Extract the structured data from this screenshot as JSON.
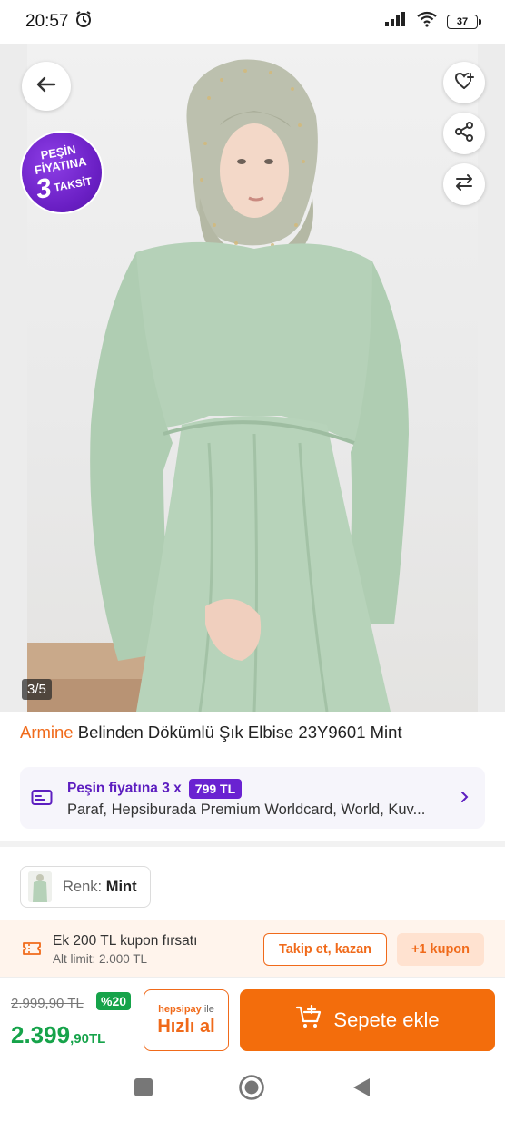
{
  "status_bar": {
    "time": "20:57",
    "battery": "37"
  },
  "gallery": {
    "page_counter": "3/5",
    "promo_badge": {
      "line1": "PEŞİN",
      "line2": "FİYATINA",
      "line3_big": "3",
      "line3_small": "TAKSİT"
    }
  },
  "product": {
    "brand": "Armine",
    "name": "Belinden Dökümlü Şık Elbise 23Y9601 Mint"
  },
  "installment": {
    "label": "Peşin fiyatına 3 x",
    "amount": "799 TL",
    "banks": "Paraf, Hepsiburada Premium Worldcard, World, Kuv..."
  },
  "color": {
    "label": "Renk:",
    "value": "Mint"
  },
  "coupon": {
    "title": "Ek 200 TL kupon fırsatı",
    "subtitle": "Alt limit: 2.000 TL",
    "follow_button": "Takip et, kazan",
    "coupon_button": "+1 kupon"
  },
  "pricing": {
    "old_price": "2.999,90 TL",
    "discount": "%20",
    "price_main": "2.399",
    "price_decimal": ",90",
    "currency": "TL"
  },
  "buttons": {
    "fast_buy_brand": "hepsipay",
    "fast_buy_with": "ile",
    "fast_buy": "Hızlı al",
    "add_to_cart": "Sepete ekle"
  },
  "colors": {
    "accent_orange": "#f36d0c",
    "brand_orange": "#f06a1a",
    "purple": "#6a22d1",
    "green": "#16a34a"
  }
}
